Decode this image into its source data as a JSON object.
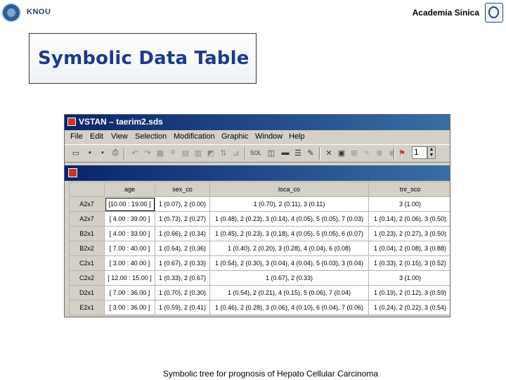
{
  "header": {
    "left_logo_text": "KNOU",
    "right_text": "Academia Sinica"
  },
  "slide": {
    "title": "Symbolic Data Table",
    "caption": "Symbolic tree for prognosis of Hepato Cellular Carcinoma"
  },
  "window": {
    "title": "VSTAN – taerim2.sds",
    "menus": [
      "File",
      "Edit",
      "View",
      "Selection",
      "Modification",
      "Graphic",
      "Window",
      "Help"
    ],
    "zoom_value": "1"
  },
  "table": {
    "columns": [
      "age",
      "sex_co",
      "loca_co",
      "tnr_sco"
    ],
    "rows": [
      {
        "label": "A2x7",
        "cells": [
          "[10.00 : 19.00 ]",
          "1 (0.07), 2 (0.00)",
          "1 (0.70), 2 (0.11), 3 (0.11)",
          "3 (1.00)"
        ]
      },
      {
        "label": "A2x7",
        "cells": [
          "[ 4.00 : 39.00 ]",
          "1 (0.73), 2 (0.27)",
          "1 (0.48), 2 (0.23), 3 (0.14), 4 (0.05), 5 (0.05), 7 (0.03)",
          "1 (0.14), 2 (0.06), 3 (0.50)"
        ]
      },
      {
        "label": "B2x1",
        "cells": [
          "[ 4.00 : 33.00 ]",
          "1 (0.66), 2 (0.34)",
          "1 (0.45), 2 (0.23), 3 (0.18), 4 (0.05), 5 (0.05), 6 (0.07)",
          "1 (0.23), 2 (0.27), 3 (0.50)"
        ]
      },
      {
        "label": "B2x2",
        "cells": [
          "[ 7.00 : 40.00 ]",
          "1 (0.64), 2 (0.36)",
          "1 (0.40), 2 (0.20), 3 (0.28), 4 (0.04), 6 (0.08)",
          "1 (0.04), 2 (0.08), 3 (0.88)"
        ]
      },
      {
        "label": "C2x1",
        "cells": [
          "[ 3.00 : 40.00 ]",
          "1 (0.67), 2 (0.33)",
          "1 (0.54), 2 (0.30), 3 (0.04), 4 (0.04), 5 (0.03), 3 (0.04)",
          "1 (0.33), 2 (0.15), 3 (0.52)"
        ]
      },
      {
        "label": "C2x2",
        "cells": [
          "[ 12.00 : 15.00 ]",
          "1 (0.33), 2 (0.67)",
          "1 (0.67), 2 (0.33)",
          "3 (1.00)"
        ]
      },
      {
        "label": "D2x1",
        "cells": [
          "[ 7.00 : 36.00 ]",
          "1 (0.70), 2 (0.30)",
          "1 (0.54), 2 (0.21), 4 (0.15), 5 (0.06), 7 (0.04)",
          "1 (0.19), 2 (0.12), 3 (0.59)"
        ]
      },
      {
        "label": "E2x1",
        "cells": [
          "[ 3.00 : 36.00 ]",
          "1 (0.59), 2 (0.41)",
          "1 (0.46), 2 (0.28), 3 (0.06), 4 (0.10), 6 (0.04), 7 (0.06)",
          "1 (0.24), 2 (0.22), 3 (0.54)"
        ]
      }
    ]
  }
}
